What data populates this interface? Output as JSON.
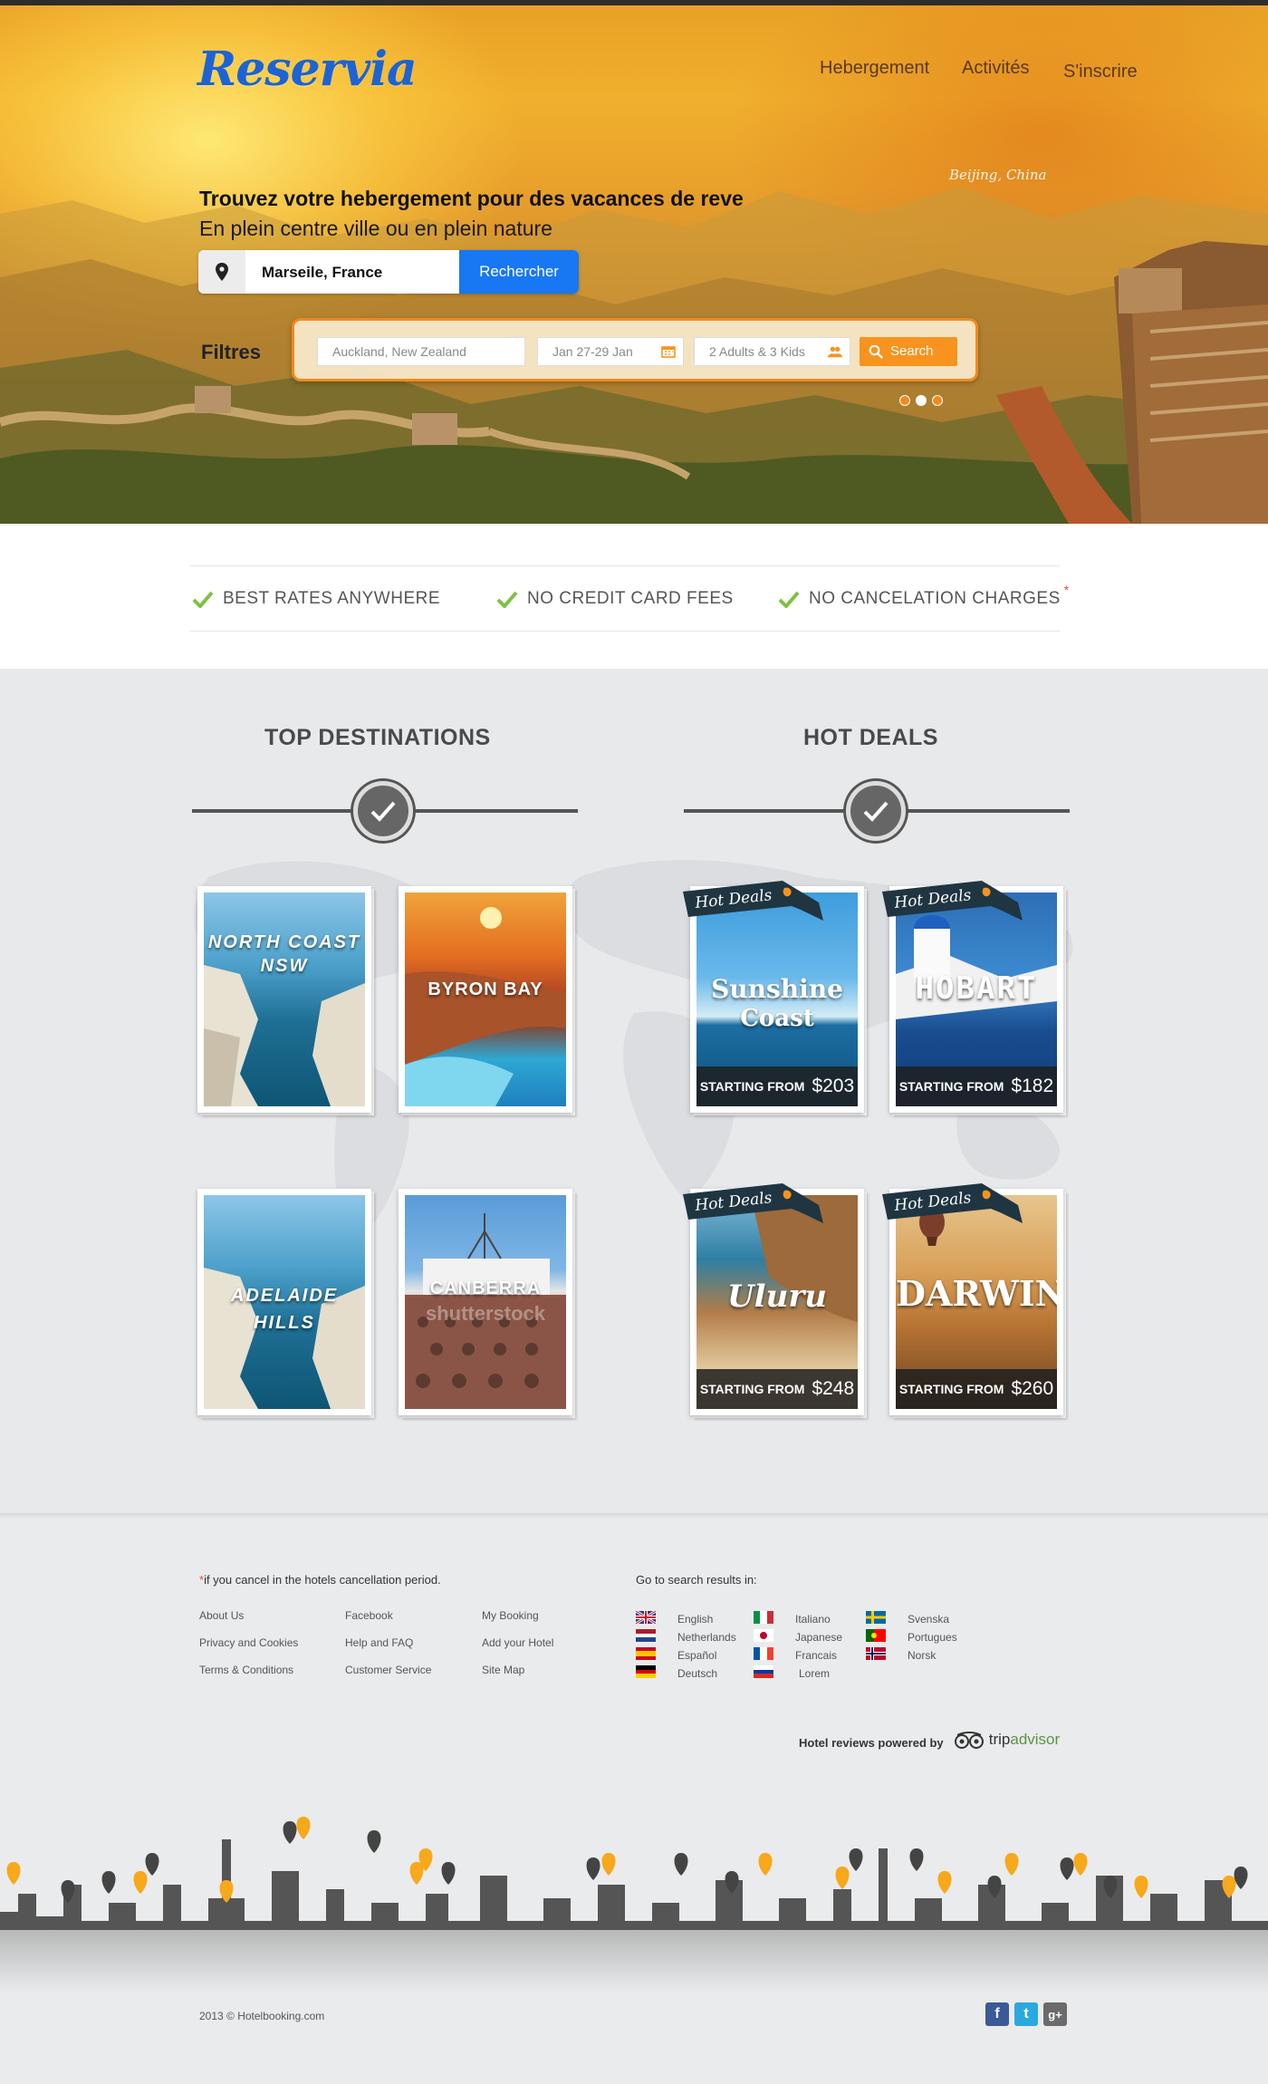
{
  "brand": {
    "name": "Reservia",
    "accent": "#1877f2"
  },
  "nav": {
    "items": [
      "Hebergement",
      "Activités",
      "S'inscrire"
    ]
  },
  "hero": {
    "caption": "Beijing, China",
    "headline": "Trouvez votre hebergement pour des vacances de reve",
    "subline": "En plein centre ville ou en plein nature",
    "search": {
      "location": "Marseile, France",
      "button": "Rechercher",
      "icon": "map-pin-icon"
    },
    "filters": {
      "label": "Filtres",
      "destination": "Auckland, New Zealand",
      "dates": "Jan 27-29 Jan",
      "guests": "2 Adults & 3 Kids",
      "search_button": "Search",
      "accent": "#f7931e"
    }
  },
  "features": [
    {
      "label": "BEST RATES ANYWHERE"
    },
    {
      "label": "NO CREDIT CARD FEES"
    },
    {
      "label": "NO CANCELATION CHARGES",
      "asterisk": "*"
    }
  ],
  "sections": {
    "top_destinations": {
      "title": "TOP DESTINATIONS",
      "cards": [
        {
          "label": "NORTH COAST NSW",
          "line1": "NORTH COAST",
          "line2": "NSW"
        },
        {
          "label": "BYRON BAY"
        },
        {
          "label": "ADELAIDE HILLS",
          "line1": "ADELAIDE",
          "line2": "HILLS"
        },
        {
          "label": "CANBERRA",
          "watermark": "shutterstock"
        }
      ]
    },
    "hot_deals": {
      "title": "HOT DEALS",
      "ribbon": "Hot Deals",
      "price_prefix": "STARTING FROM",
      "cards": [
        {
          "label": "Sunshine Coast",
          "line1": "Sunshine",
          "line2": "Coast",
          "price": "$203"
        },
        {
          "label": "HOBART",
          "price": "$182"
        },
        {
          "label": "Uluru",
          "price": "$248"
        },
        {
          "label": "DARWIN",
          "price": "$260"
        }
      ]
    }
  },
  "footer": {
    "note_star": "*",
    "note": "if you cancel in the hotels cancellation period.",
    "links": [
      [
        "About Us",
        "Privacy and Cookies",
        "Terms & Conditions"
      ],
      [
        "Facebook",
        "Help and FAQ",
        "Customer Service"
      ],
      [
        "My Booking",
        "Add your Hotel",
        "Site Map"
      ]
    ],
    "languages_label": "Go to search results in:",
    "languages": [
      [
        "English",
        "Netherlands",
        "Español",
        "Deutsch"
      ],
      [
        "Italiano",
        "Japanese",
        "Francais",
        "Lorem"
      ],
      [
        "Svenska",
        "Portugues",
        "Norsk"
      ]
    ],
    "powered": "Hotel reviews powered by",
    "tripadvisor": [
      "trip",
      "advisor"
    ],
    "copyright": "2013 ©  Hotelbooking.com",
    "social": [
      {
        "icon": "facebook-icon",
        "glyph": "f",
        "color": "#3b5998"
      },
      {
        "icon": "twitter-icon",
        "glyph": "t",
        "color": "#2aa9e0"
      },
      {
        "icon": "google-plus-icon",
        "glyph": "g+",
        "color": "#6b6b6b"
      }
    ]
  }
}
